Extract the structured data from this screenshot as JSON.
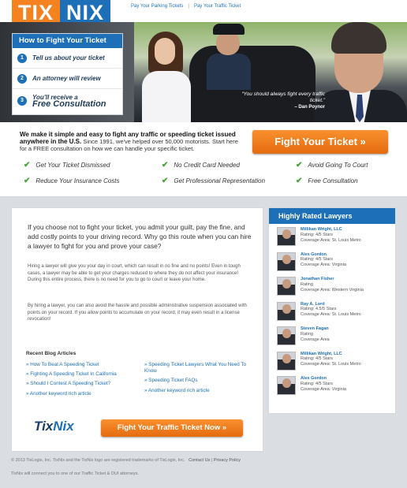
{
  "brand": {
    "tix": "TIX",
    "nix": "NIX"
  },
  "top_links": [
    "Pay Your Parking Tickets",
    "|",
    "Pay Your Traffic Ticket"
  ],
  "how_to": {
    "title": "How to Fight Your Ticket",
    "steps": [
      {
        "num": "1",
        "text": "Tell us about your ticket"
      },
      {
        "num": "2",
        "text": "An attorney will review"
      },
      {
        "num": "3",
        "text": "You'll receive a",
        "big": "Free Consultation"
      }
    ]
  },
  "hero_quote": {
    "text": "“You should always fight every traffic ticket.”",
    "by": "– Dan Poynor"
  },
  "intro": {
    "bold": "We make it simple and easy to fight any traffic or speeding ticket issued anywhere in the U.S.",
    "rest": " Since 1991, we've helped over 50,000 motorists. Start here for a FREE consultation on how we can handle your specific ticket."
  },
  "fight_button": "Fight Your Ticket »",
  "benefits": [
    "Get Your Ticket Dismissed",
    "No Credit Card Needed",
    "Avoid Going To Court",
    "Reduce Your Insurance Costs",
    "Get Professional Representation",
    "Free Consultation"
  ],
  "main": {
    "lead": "If you choose not to fight your ticket, you admit your guilt, pay the fine, and add costly points to your driving record. Why go this route when you can hire a lawyer to fight for you and prove your case?",
    "para1": "Hiring a lawyer will give you your day in court, which can result in no fine and no points! Even in tough cases, a lawyer may be able to get your charges reduced to where they do not affect your insurance! During this entire process, there is no need for you to go to court or leave your home.",
    "para2": "By hiring a lawyer, you can also avoid the hassle and possible administrative suspension associated with points on your record. If you allow points to accumulate on your record, it may even result in a license revocation!",
    "blog_title": "Recent Blog Articles",
    "blog_col1": [
      "» How To Beat A Speeding Ticket",
      "» Fighting A Speeding Ticket In California",
      "» Should I Contest A Speeding Ticket?",
      "» Another keyword rich article"
    ],
    "blog_col2": [
      "» Speeding Ticket Lawyers What You Need To Know",
      "» Speeding Ticket FAQs",
      "» Another keyword rich article"
    ],
    "logo_a": "Tix",
    "logo_b": "Nix",
    "cta": "Fight Your Traffic Ticket Now »"
  },
  "lawyers_title": "Highly Rated Lawyers",
  "lawyers": [
    {
      "name": "Millikan Wright, LLC",
      "rating": "Rating: 4/5 Stars",
      "area": "Coverage Area: St. Louis Metro"
    },
    {
      "name": "Alex Gordon",
      "rating": "Rating: 4/5 Stars",
      "area": "Coverage Area: Virginia"
    },
    {
      "name": "Jonathan Fisher",
      "rating": "Rating",
      "area": "Coverage Area: Western Virginia"
    },
    {
      "name": "Ray A. Lord",
      "rating": "Rating: 4.5/5 Stars",
      "area": "Coverage Area: St. Louis Metro"
    },
    {
      "name": "Steven Fagan",
      "rating": "Rating",
      "area": "Coverage Area"
    },
    {
      "name": "Millikan Wright, LLC",
      "rating": "Rating: 4/5 Stars",
      "area": "Coverage Area: St. Louis Metro"
    },
    {
      "name": "Alex Gordon",
      "rating": "Rating: 4/5 Stars",
      "area": "Coverage Area: Virginia"
    }
  ],
  "footer": {
    "copyright": "© 2013 TixLogix, Inc. TixNix and the TixNix logo are registered trademarks of TixLogix, Inc.",
    "contact": "Contact Us",
    "sep": "|",
    "privacy": "Privacy Policy",
    "note": "TixNix will connect you to one of our Traffic Ticket & DUI attorneys."
  },
  "colors": {
    "orange": "#f58220",
    "blue": "#1d6fb8",
    "check": "#47a33a"
  }
}
